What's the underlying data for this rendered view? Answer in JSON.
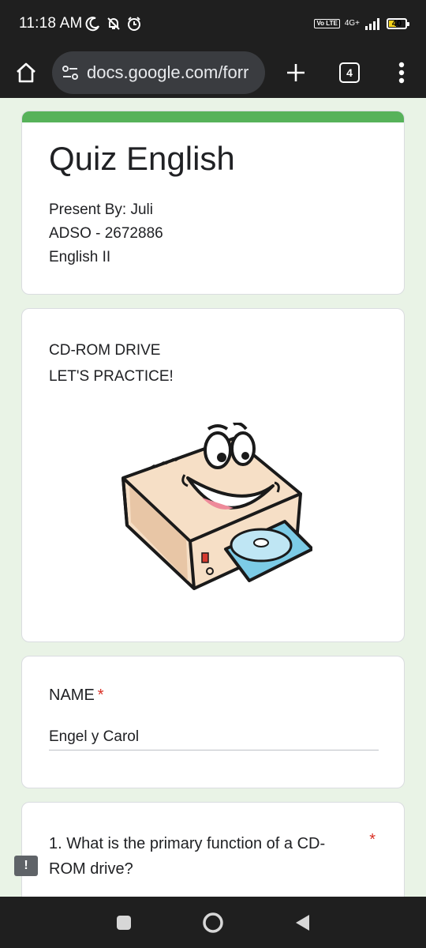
{
  "status": {
    "time": "11:18 AM",
    "volte": "Vo LTE",
    "network": "4G+",
    "battery": "40"
  },
  "browser": {
    "url": "docs.google.com/forr",
    "tab_count": "4"
  },
  "form": {
    "title": "Quiz English",
    "description": [
      "Present By: Juli",
      "ADSO - 2672886",
      "English II"
    ],
    "section_lines": [
      "CD-ROM DRIVE",
      "LET'S PRACTICE!"
    ],
    "name_question": {
      "label": "NAME",
      "required": "*",
      "answer": "Engel y Carol"
    },
    "question1": {
      "text": "1. What is the primary function of a CD-ROM drive?",
      "required": "*"
    }
  },
  "feedback_icon": "!",
  "colors": {
    "header_accent": "#57b25a",
    "page_bg": "#e9f3e6",
    "required": "#d93025"
  }
}
